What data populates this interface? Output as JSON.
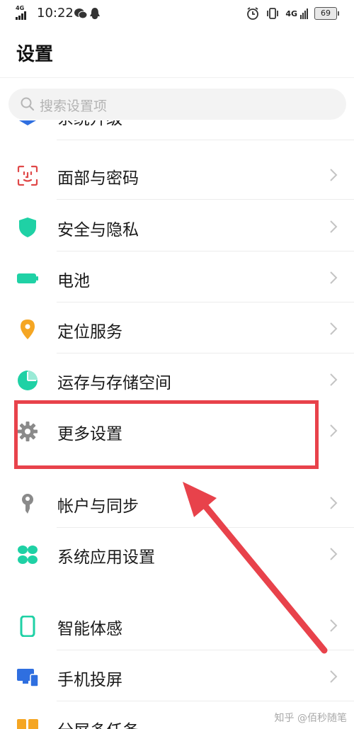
{
  "status_bar": {
    "network_type": "4G",
    "time": "10:22",
    "right_network": "4G",
    "battery": "69"
  },
  "header": {
    "title": "设置"
  },
  "search": {
    "placeholder": "搜索设置项"
  },
  "settings_items": [
    {
      "label": "系统升级",
      "icon": "system-update-icon"
    },
    {
      "label": "面部与密码",
      "icon": "face-password-icon"
    },
    {
      "label": "安全与隐私",
      "icon": "shield-icon"
    },
    {
      "label": "电池",
      "icon": "battery-icon"
    },
    {
      "label": "定位服务",
      "icon": "location-icon"
    },
    {
      "label": "运存与存储空间",
      "icon": "storage-pie-icon"
    },
    {
      "label": "更多设置",
      "icon": "gear-icon"
    },
    {
      "label": "帐户与同步",
      "icon": "key-icon"
    },
    {
      "label": "系统应用设置",
      "icon": "apps-grid-icon"
    },
    {
      "label": "智能体感",
      "icon": "phone-motion-icon"
    },
    {
      "label": "手机投屏",
      "icon": "screen-cast-icon"
    },
    {
      "label": "分屏多任务",
      "icon": "split-screen-icon"
    }
  ],
  "highlighted_item": "更多设置",
  "watermark": "知乎 @佰秒随笔",
  "colors": {
    "highlight": "#e8424b",
    "teal": "#1fd1a5",
    "orange": "#f5a623",
    "blue": "#2f6fe0",
    "face_red": "#e04848",
    "gray": "#8a8a8a"
  }
}
